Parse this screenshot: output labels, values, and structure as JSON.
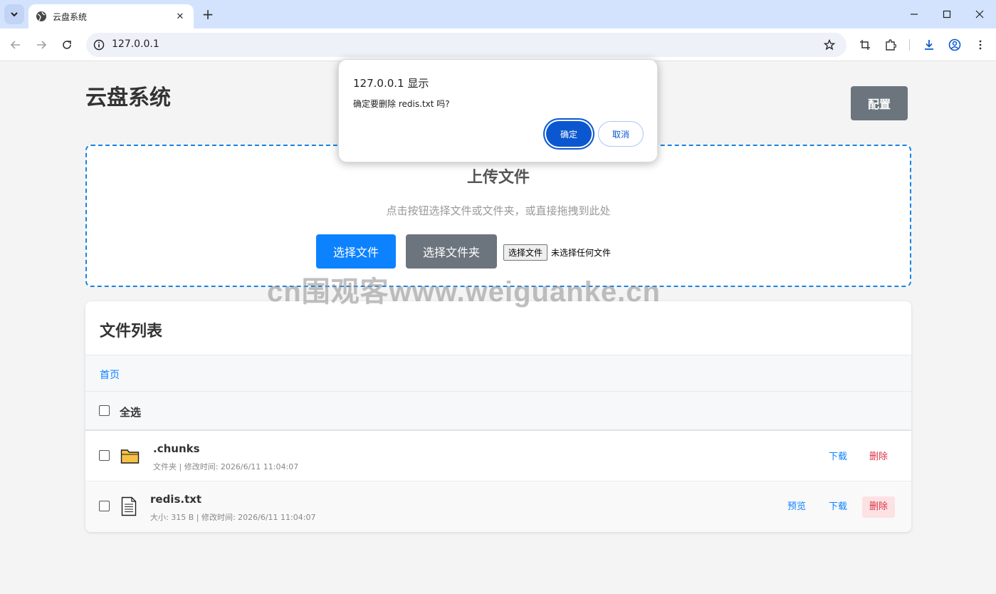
{
  "browser": {
    "tab_title": "云盘系统",
    "url": "127.0.0.1"
  },
  "page": {
    "title": "云盘系统",
    "config_label": "配置"
  },
  "upload": {
    "title": "上传文件",
    "hint": "点击按钮选择文件或文件夹，或直接拖拽到此处",
    "select_file_label": "选择文件",
    "select_folder_label": "选择文件夹",
    "native_button_label": "选择文件",
    "native_status": "未选择任何文件"
  },
  "watermark": "cn围观客www.weiguanke.cn",
  "file_list": {
    "title": "文件列表",
    "breadcrumb_home": "首页",
    "select_all_label": "全选",
    "rows": [
      {
        "name": ".chunks",
        "meta": "文件夹 | 修改时间: 2026/6/11 11:04:07",
        "type": "folder",
        "download_label": "下载",
        "delete_label": "删除"
      },
      {
        "name": "redis.txt",
        "meta": "大小: 315 B | 修改时间: 2026/6/11 11:04:07",
        "type": "file",
        "preview_label": "预览",
        "download_label": "下载",
        "delete_label": "删除"
      }
    ]
  },
  "dialog": {
    "title": "127.0.0.1 显示",
    "message": "确定要删除 redis.txt 吗?",
    "ok_label": "确定",
    "cancel_label": "取消"
  },
  "colors": {
    "primary": "#0d82ff",
    "secondary": "#6c757d",
    "danger": "#dc3545",
    "dialog_accent": "#0b57d0"
  }
}
